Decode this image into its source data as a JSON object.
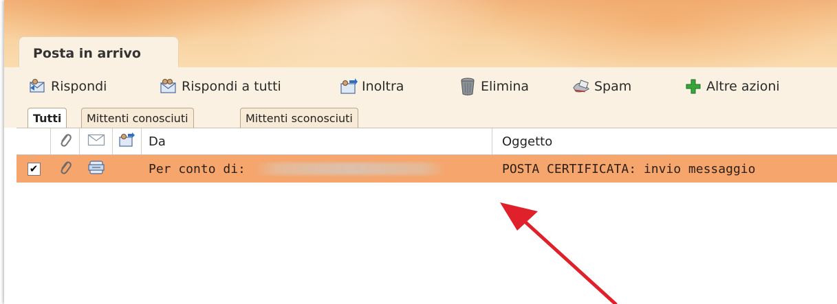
{
  "main_tab": {
    "label": "Posta in arrivo"
  },
  "toolbar": {
    "buttons": [
      {
        "label": "Rispondi",
        "icon": "reply-icon"
      },
      {
        "label": "Rispondi a tutti",
        "icon": "reply-all-icon"
      },
      {
        "label": "Inoltra",
        "icon": "forward-icon"
      },
      {
        "label": "Elimina",
        "icon": "trash-icon"
      },
      {
        "label": "Spam",
        "icon": "spam-icon"
      },
      {
        "label": "Altre azioni",
        "icon": "plus-icon"
      }
    ]
  },
  "filter_tabs": [
    {
      "label": "Tutti",
      "active": true
    },
    {
      "label": "Mittenti conosciuti",
      "active": false
    },
    {
      "label": "Mittenti sconosciuti",
      "active": false
    }
  ],
  "table": {
    "columns": {
      "from": "Da",
      "subject": "Oggetto"
    },
    "rows": [
      {
        "selected": true,
        "checked_glyph": "✔",
        "from": "Per conto di:",
        "subject": "POSTA CERTIFICATA: invio messaggio"
      }
    ]
  },
  "colors": {
    "selected_row": "#f6a56c",
    "toolbar_bg": "#fbf1e2",
    "annotation_arrow": "#e0202a"
  }
}
